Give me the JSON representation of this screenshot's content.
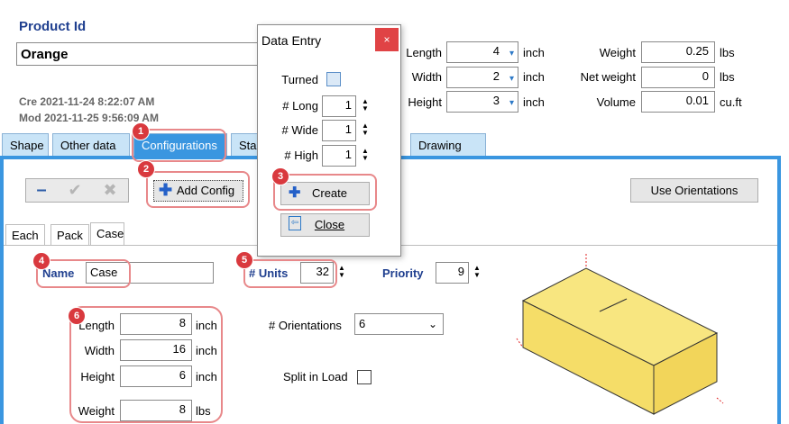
{
  "product": {
    "id_label": "Product Id",
    "id_value": "Orange",
    "created": "Cre 2021-11-24 8:22:07 AM",
    "modified": "Mod 2021-11-25 9:56:09 AM"
  },
  "dims": {
    "length_label": "Length",
    "length_value": "4",
    "length_unit": "inch",
    "width_label": "Width",
    "width_value": "2",
    "width_unit": "inch",
    "height_label": "Height",
    "height_value": "3",
    "height_unit": "inch",
    "weight_label": "Weight",
    "weight_value": "0.25",
    "weight_unit": "lbs",
    "net_label": "Net weight",
    "net_value": "0",
    "net_unit": "lbs",
    "volume_label": "Volume",
    "volume_value": "0.01",
    "volume_unit": "cu.ft"
  },
  "tabs": [
    "Shape",
    "Other data",
    "Configurations",
    "Sta",
    "Drawing"
  ],
  "toolbar": {
    "add_config": "Add Config",
    "use_orientations": "Use Orientations"
  },
  "subtabs": [
    "Each",
    "Pack",
    "Case"
  ],
  "config": {
    "name_label": "Name",
    "name_value": "Case",
    "units_label": "# Units",
    "units_value": "32",
    "priority_label": "Priority",
    "priority_value": "9",
    "length_label": "Length",
    "length_value": "8",
    "length_unit": "inch",
    "width_label": "Width",
    "width_value": "16",
    "width_unit": "inch",
    "height_label": "Height",
    "height_value": "6",
    "height_unit": "inch",
    "weight_label": "Weight",
    "weight_value": "8",
    "weight_unit": "lbs",
    "orient_label": "# Orientations",
    "orient_value": "6",
    "split_label": "Split in Load"
  },
  "dialog": {
    "title": "Data Entry",
    "close_x": "×",
    "turned_label": "Turned",
    "long_label": "# Long",
    "long_value": "1",
    "wide_label": "# Wide",
    "wide_value": "1",
    "high_label": "# High",
    "high_value": "1",
    "create_label": "Create",
    "close_label": "Close"
  },
  "badges": [
    "1",
    "2",
    "3",
    "4",
    "5",
    "6"
  ],
  "colors": {
    "accent": "#3a96e0",
    "callout": "#e8888a",
    "badge": "#d9393e",
    "box": "#f7e27a"
  }
}
